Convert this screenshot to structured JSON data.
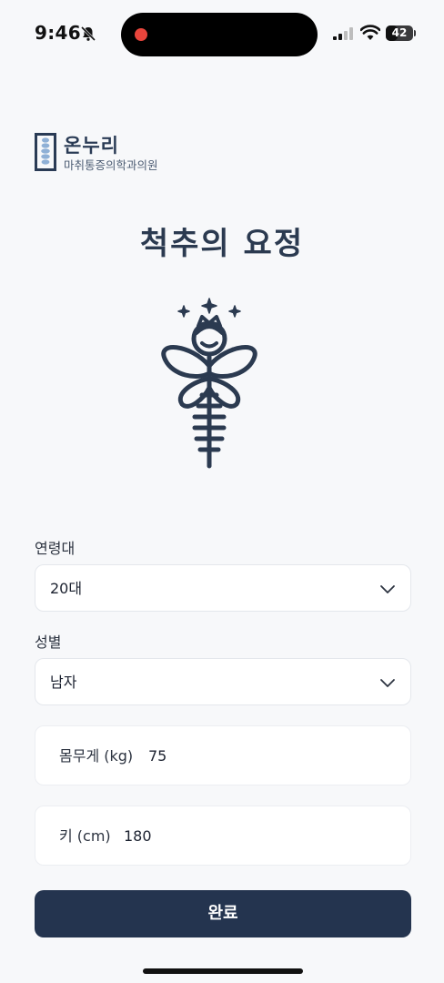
{
  "status_bar": {
    "time": "9:46",
    "battery": "42",
    "battery_level": 0.42
  },
  "clinic": {
    "name": "온누리",
    "subtitle": "마취통증의학과의원"
  },
  "app_title": "척추의 요정",
  "form": {
    "age_group": {
      "label": "연령대",
      "value": "20대"
    },
    "gender": {
      "label": "성별",
      "value": "남자"
    },
    "weight": {
      "label": "몸무게 (kg)",
      "value": "75"
    },
    "height": {
      "label": "키 (cm)",
      "value": "180"
    },
    "submit_label": "완료"
  },
  "colors": {
    "primary": "#24344f",
    "accent_red": "#e8453c",
    "background": "#f7f8fa"
  }
}
